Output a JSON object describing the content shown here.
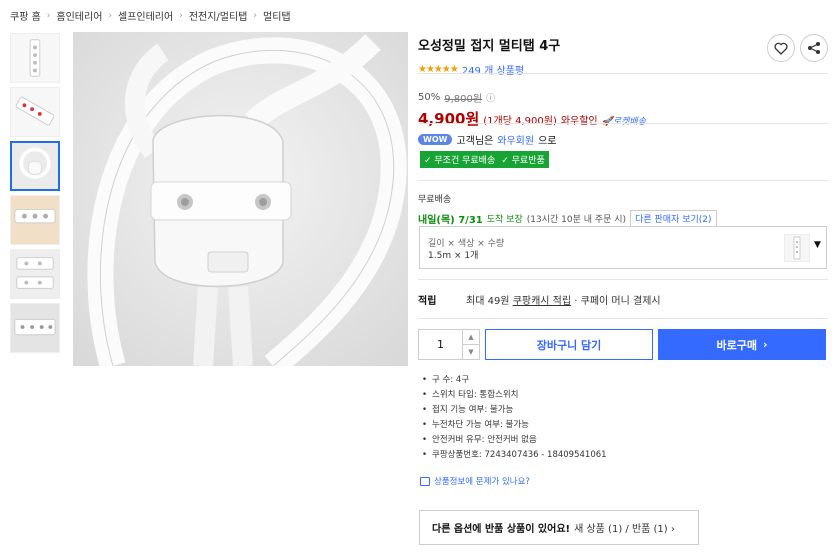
{
  "breadcrumb": [
    "쿠팡 홈",
    "홈인테리어",
    "셀프인테리어",
    "전전지/멀티탭",
    "멀티탭"
  ],
  "product": {
    "title": "오성정밀 접지 멀티탭 4구",
    "stars": "★★★★★",
    "review_count": "249 개 상품평",
    "discount_rate": "50%",
    "original_price": "9,800원",
    "price": "4,900원",
    "unit_price": "(1개당 4,900원)",
    "wow_sale": "와우할인",
    "rocket_label": "로켓배송"
  },
  "wow": {
    "badge": "WOW",
    "prefix": "고객님은",
    "link": "와우회원",
    "suffix": "으로",
    "benefits": [
      "✓ 무조건 무료배송",
      "✓ 무료반품"
    ]
  },
  "shipping": {
    "label": "무료배송",
    "date": "내일(목) 7/31",
    "guarantee": "도착 보장",
    "note": "(13시간 10분 내 주문 시)",
    "other_seller": "다른 판매자 보기(2)"
  },
  "option": {
    "header": "길이 × 색상 × 수량",
    "value": "1.5m × 1개"
  },
  "points": {
    "label": "적립",
    "text_prefix": "최대 49원",
    "text_link": "쿠팡캐시 적립",
    "text_suffix": "· 쿠페이 머니 결제시"
  },
  "purchase": {
    "quantity": "1",
    "cart_label": "장바구니 담기",
    "buy_label": "바로구매",
    "buy_chevron": "›"
  },
  "specs": [
    "구 수: 4구",
    "스위치 타입: 통합스위치",
    "접지 기능 여부: 불가능",
    "누전차단 가능 여부: 불가능",
    "안전커버 유무: 안전커버 없음",
    "쿠팡상품번호: 7243407436 - 18409541061"
  ],
  "report_text": "상품정보에 문제가 있나요?",
  "return_offer": {
    "bold": "다른 옵션에 반품 상품이 있어요!",
    "rest": "새 상품 (1) / 반품 (1) ›"
  },
  "colors": {
    "price_red": "#ae0000",
    "brand_blue": "#346aff",
    "wow_green": "#17a434",
    "star_orange": "#f3a004"
  }
}
